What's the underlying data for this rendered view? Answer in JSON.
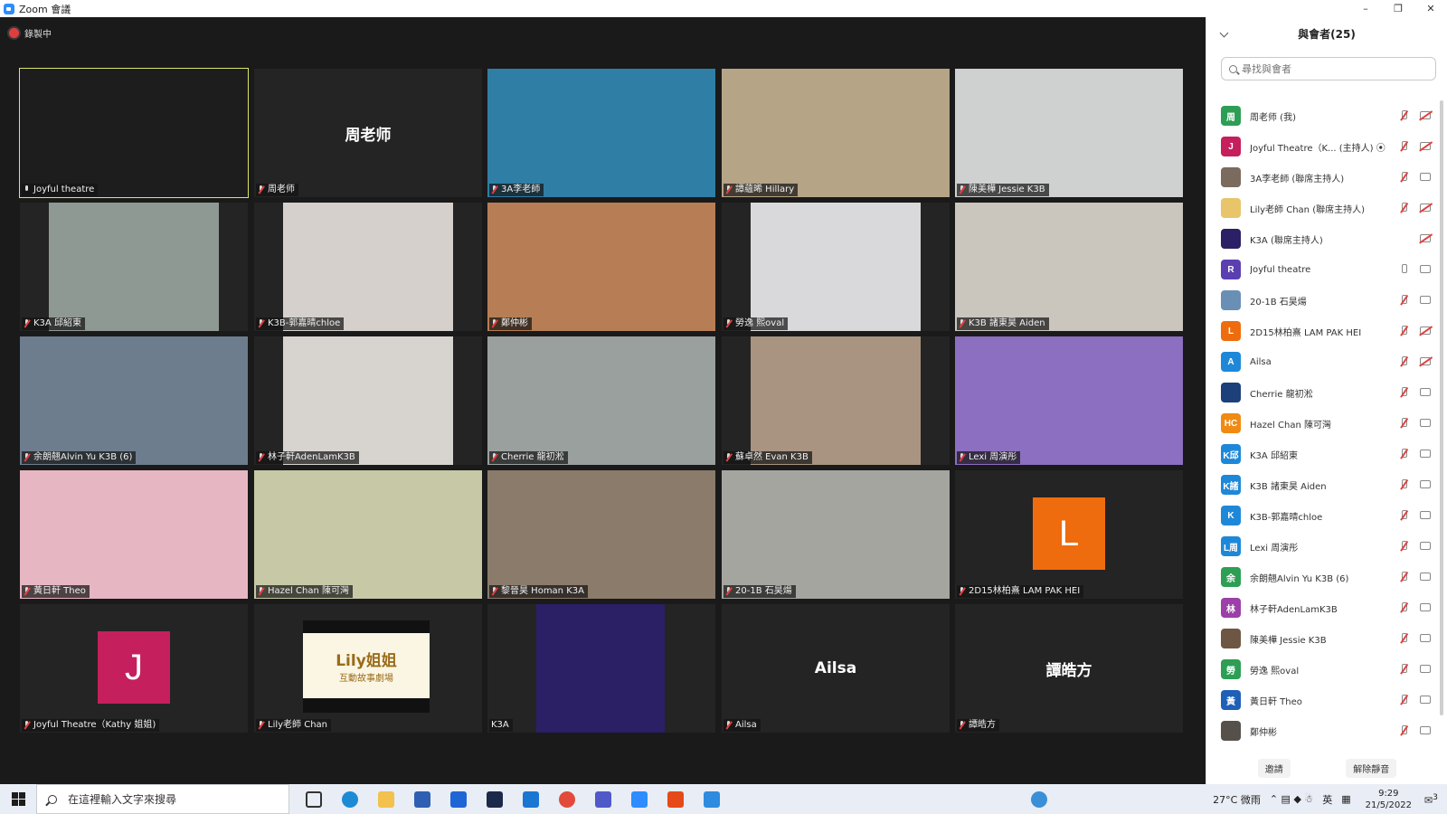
{
  "window": {
    "title": "Zoom 會議"
  },
  "recording": {
    "label": "錄製中"
  },
  "tiles": [
    {
      "name": "Joyful theatre",
      "mic": "on",
      "bg": "#1d1d1d"
    },
    {
      "name": "周老师",
      "mic": "muted",
      "display_name": "周老师"
    },
    {
      "name": "3A李老師",
      "mic": "muted",
      "bg": "#2f7ea6"
    },
    {
      "name": "譚蘊晞 Hillary",
      "mic": "muted",
      "bg": "#b6a487"
    },
    {
      "name": "陳美樺 Jessie K3B",
      "mic": "muted",
      "bg": "#cfd1d1"
    },
    {
      "name": "K3A 邱紹東",
      "mic": "muted",
      "bg": "#8f9994"
    },
    {
      "name": "K3B-郭嘉晴chloe",
      "mic": "muted",
      "bg": "#d5d0cb"
    },
    {
      "name": "鄭仲彬",
      "mic": "muted",
      "bg": "#b77e55"
    },
    {
      "name": "勞逸 熙oval",
      "mic": "muted",
      "bg": "#d9d9dc"
    },
    {
      "name": "K3B 諸東昊 Aiden",
      "mic": "muted",
      "bg": "#cbc6bd"
    },
    {
      "name": "余朗翹Alvin Yu K3B (6)",
      "mic": "muted",
      "bg": "#6d7d8e"
    },
    {
      "name": "林子軒AdenLamK3B",
      "mic": "muted",
      "bg": "#d7d4d0"
    },
    {
      "name": "Cherrie 龍初淞",
      "mic": "muted",
      "bg": "#9aa09e"
    },
    {
      "name": "蘇卓然 Evan K3B",
      "mic": "muted",
      "bg": "#a89480"
    },
    {
      "name": "Lexi 周演彤",
      "mic": "muted",
      "bg": "#8c6fc0"
    },
    {
      "name": "黃日軒 Theo",
      "mic": "muted",
      "bg": "#e7b6c3"
    },
    {
      "name": "Hazel Chan 陳可灣",
      "mic": "muted",
      "bg": "#c7c8a6"
    },
    {
      "name": "黎晉昊 Homan K3A",
      "mic": "muted",
      "bg": "#8b7b6b"
    },
    {
      "name": "20-1B 石昊煬",
      "mic": "muted",
      "bg": "#a5a5a0"
    },
    {
      "name": "2D15林柏熹 LAM PAK HEI",
      "mic": "muted",
      "avatar_letter": "L",
      "avatar_color": "#ef6c0e"
    },
    {
      "name": "Joyful Theatre（Kathy 姐姐)",
      "mic": "muted",
      "avatar_letter": "J",
      "avatar_color": "#c51f5d"
    },
    {
      "name": "Lily老師 Chan",
      "mic": "muted",
      "logo_text": "Lily姐姐",
      "logo_sub": "互動故事劇場"
    },
    {
      "name": "K3A",
      "mic": "none",
      "bg": "#2b1f66"
    },
    {
      "name": "Ailsa",
      "mic": "muted",
      "display_name": "Ailsa"
    },
    {
      "name": "譚皓方",
      "mic": "muted",
      "display_name": "譚皓方"
    }
  ],
  "panel": {
    "title": "與會者(25)",
    "search_placeholder": "尋找與會者",
    "invite_label": "邀請",
    "unmute_label": "解除靜音",
    "participants": [
      {
        "initials": "周",
        "color": "#2e9e55",
        "name": "周老师 (我)",
        "mic": "muted",
        "video": "off"
      },
      {
        "initials": "J",
        "color": "#c51f5d",
        "name": "Joyful Theatre（K... (主持人) ⦿",
        "mic": "muted",
        "video": "off"
      },
      {
        "initials": "",
        "color": "#7b6a5e",
        "name": "3A李老師 (聯席主持人)",
        "mic": "muted",
        "video": "on"
      },
      {
        "initials": "",
        "color": "#e8c46a",
        "name": "Lily老師 Chan (聯席主持人)",
        "mic": "muted",
        "video": "off"
      },
      {
        "initials": "",
        "color": "#2b1f66",
        "name": "K3A (聯席主持人)",
        "mic": "none",
        "video": "off"
      },
      {
        "initials": "R",
        "color": "#5b3fb0",
        "name": "Joyful theatre",
        "mic": "on",
        "video": "on"
      },
      {
        "initials": "",
        "color": "#6a8fb5",
        "name": "20-1B 石昊煬",
        "mic": "muted",
        "video": "on"
      },
      {
        "initials": "L",
        "color": "#ef6c0e",
        "name": "2D15林柏熹 LAM PAK HEI",
        "mic": "muted",
        "video": "off"
      },
      {
        "initials": "A",
        "color": "#1e88d8",
        "name": "Ailsa",
        "mic": "muted",
        "video": "off"
      },
      {
        "initials": "",
        "color": "#1d3f7a",
        "name": "Cherrie 龍初淞",
        "mic": "muted",
        "video": "on"
      },
      {
        "initials": "HC",
        "color": "#f08a12",
        "name": "Hazel Chan 陳可灣",
        "mic": "muted",
        "video": "on"
      },
      {
        "initials": "K邱",
        "color": "#1e88d8",
        "name": "K3A 邱紹東",
        "mic": "muted",
        "video": "on"
      },
      {
        "initials": "K諸",
        "color": "#1e88d8",
        "name": "K3B 諸東昊 Aiden",
        "mic": "muted",
        "video": "on"
      },
      {
        "initials": "K",
        "color": "#1e88d8",
        "name": "K3B-郭嘉晴chloe",
        "mic": "muted",
        "video": "on"
      },
      {
        "initials": "L周",
        "color": "#1e88d8",
        "name": "Lexi 周演彤",
        "mic": "muted",
        "video": "on"
      },
      {
        "initials": "余",
        "color": "#2e9e55",
        "name": "余朗翹Alvin Yu K3B (6)",
        "mic": "muted",
        "video": "on"
      },
      {
        "initials": "林",
        "color": "#9c3fa8",
        "name": "林子軒AdenLamK3B",
        "mic": "muted",
        "video": "on"
      },
      {
        "initials": "",
        "color": "#6d5744",
        "name": "陳美樺 Jessie K3B",
        "mic": "muted",
        "video": "on"
      },
      {
        "initials": "勞",
        "color": "#2e9e55",
        "name": "勞逸 熙oval",
        "mic": "muted",
        "video": "on"
      },
      {
        "initials": "黃",
        "color": "#1e5fb8",
        "name": "黃日軒 Theo",
        "mic": "muted",
        "video": "on"
      },
      {
        "initials": "",
        "color": "#55504a",
        "name": "鄭仲彬",
        "mic": "muted",
        "video": "on"
      }
    ]
  },
  "taskbar": {
    "search_placeholder": "在這裡輸入文字來搜尋",
    "weather": "27°C 微雨",
    "ime": "英",
    "time": "9:29",
    "date": "21/5/2022",
    "notification_count": "3"
  },
  "colors": {
    "active_speaker_outline": "#dbe66a",
    "muted_red": "#e34040"
  }
}
